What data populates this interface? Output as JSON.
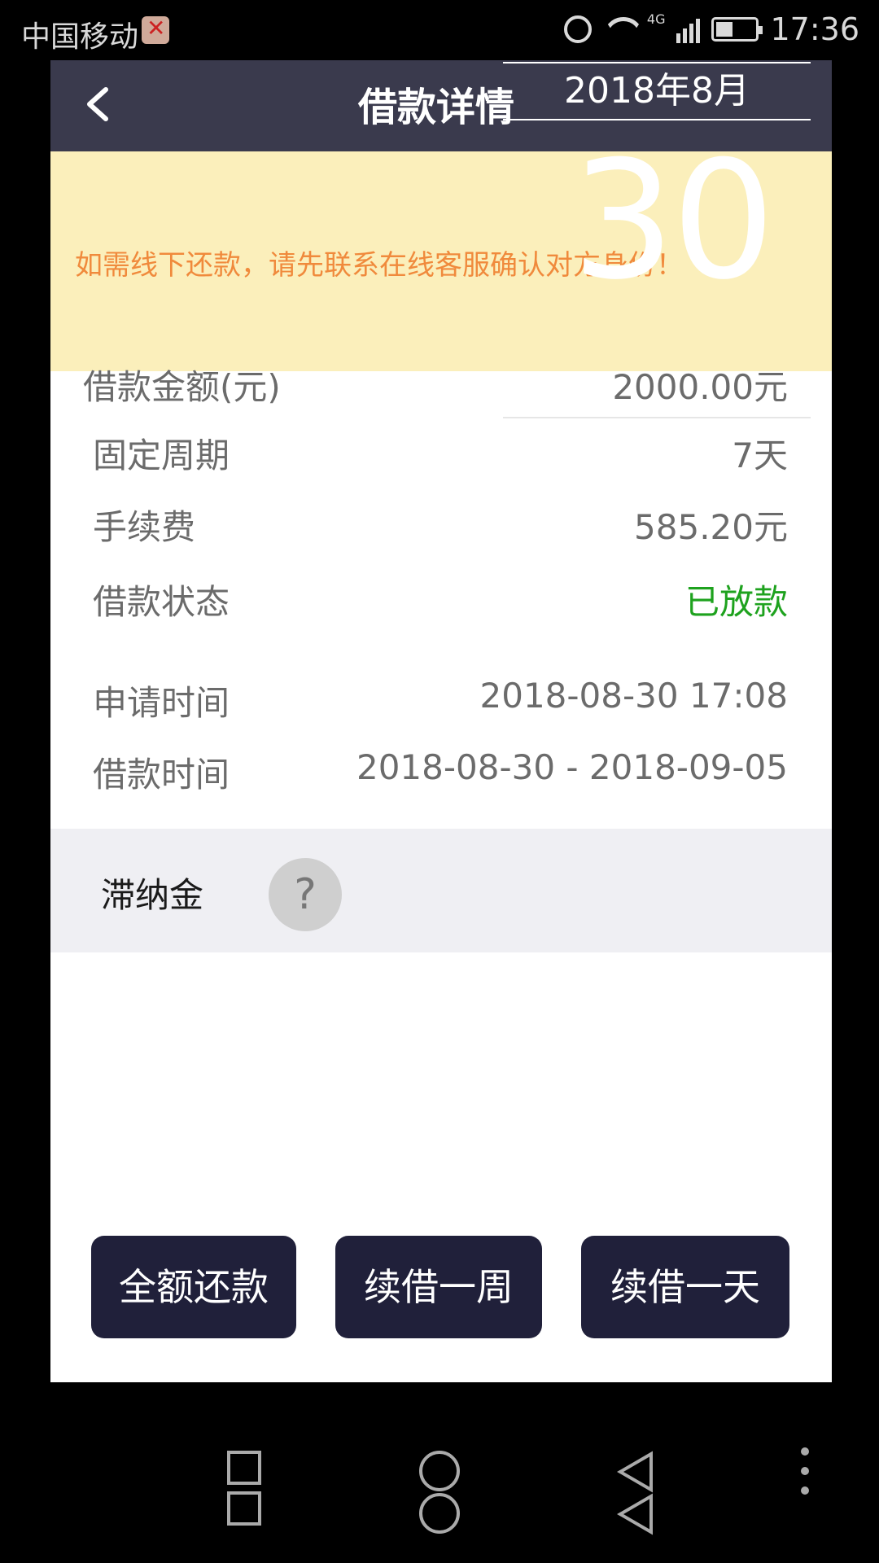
{
  "status_bar": {
    "carrier": "中国移动",
    "network": "4G",
    "time": "17:36"
  },
  "header": {
    "title": "借款详情",
    "date_overlay": "2018年8月"
  },
  "notice": {
    "text": "如需线下还款，请先联系在线客服确认对方身份！",
    "day_overlay": "30"
  },
  "details": [
    {
      "label": "借款金额(元)",
      "value": "2000.00元"
    },
    {
      "label": "固定周期",
      "value": "7天"
    },
    {
      "label": "手续费",
      "value": "585.20元"
    },
    {
      "label": "借款状态",
      "value": "已放款"
    },
    {
      "label": "申请时间",
      "value": "2018-08-30 17:08"
    },
    {
      "label": "借款时间",
      "value": "2018-08-30 - 2018-09-05"
    }
  ],
  "late_fee": {
    "label": "滞纳金",
    "help_glyph": "?"
  },
  "actions": {
    "repay_full": "全额还款",
    "renew_week": "续借一周",
    "renew_day": "续借一天"
  },
  "colors": {
    "navbar": "#3a3a4d",
    "notice_bg": "#fbefbb",
    "notice_text": "#f08a3c",
    "status_green": "#1ea21e",
    "button_bg": "#20203a"
  }
}
